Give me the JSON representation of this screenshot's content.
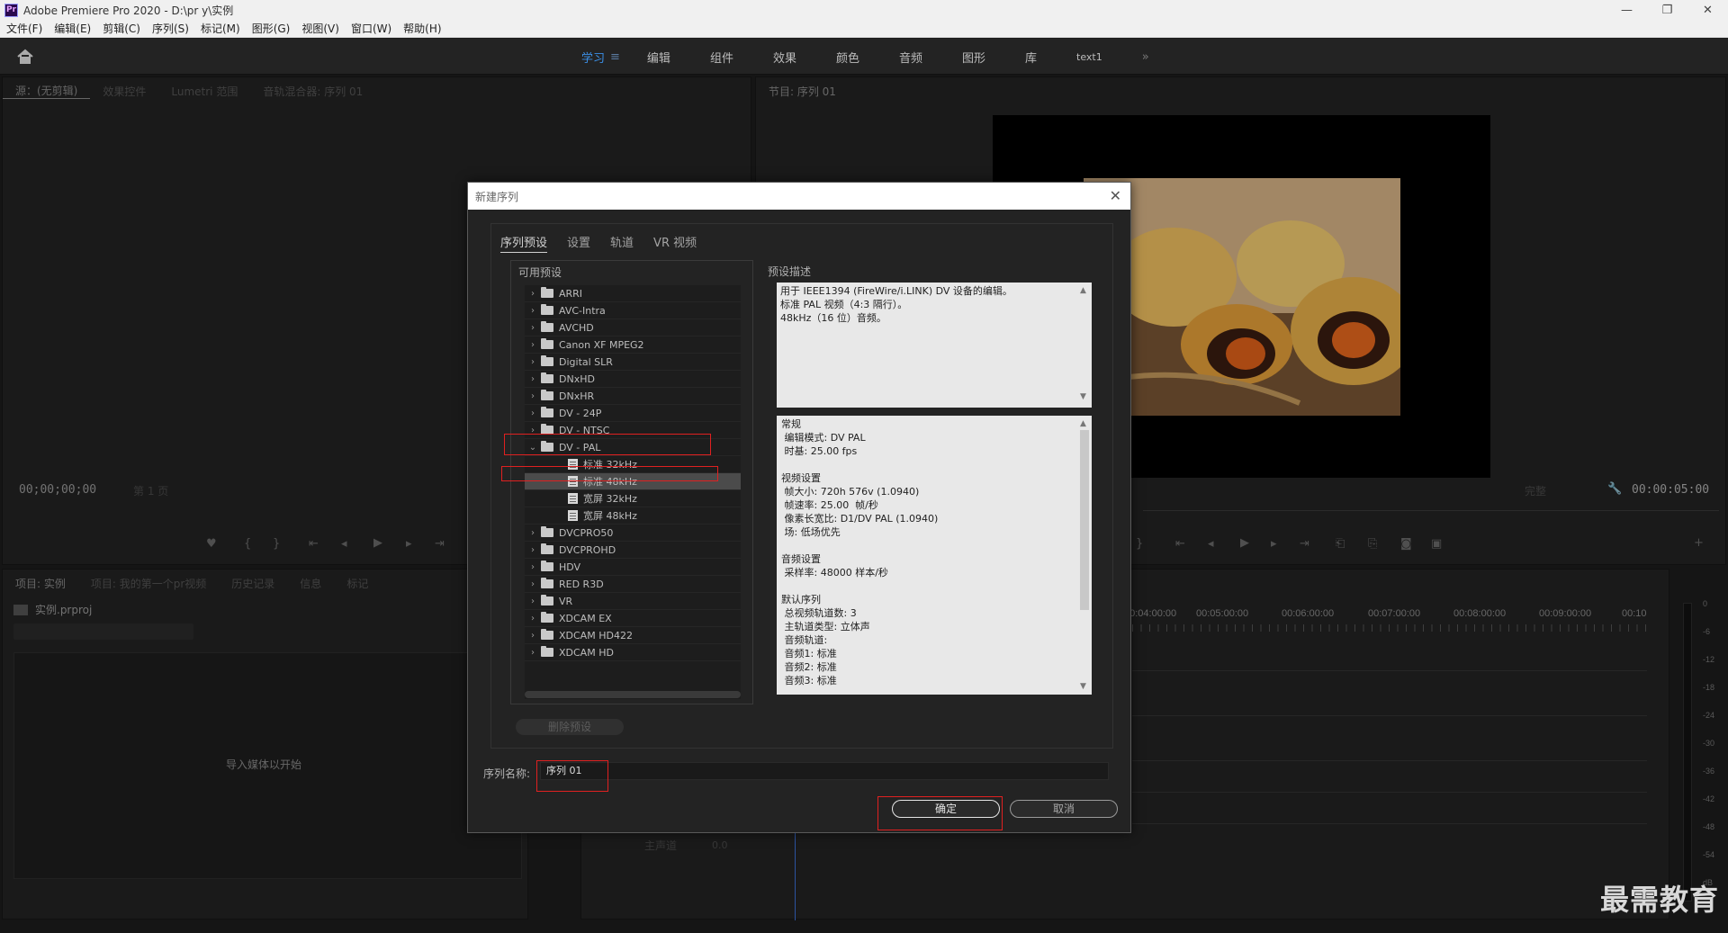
{
  "app": {
    "title": "Adobe Premiere Pro 2020 - D:\\pr y\\实例",
    "logo_text": "Pr",
    "window_controls": {
      "minimize": "—",
      "restore": "❐",
      "close": "✕"
    }
  },
  "menu": [
    "文件(F)",
    "编辑(E)",
    "剪辑(C)",
    "序列(S)",
    "标记(M)",
    "图形(G)",
    "视图(V)",
    "窗口(W)",
    "帮助(H)"
  ],
  "workspace": {
    "tabs": [
      "学习",
      "编辑",
      "组件",
      "效果",
      "颜色",
      "音频",
      "图形",
      "库",
      "text1"
    ],
    "active": "学习",
    "active_menu_glyph": "≡",
    "more_glyph": "»",
    "accent_color": "#3b8fe6"
  },
  "source_panel": {
    "tabs": [
      "源：(无剪辑)",
      "效果控件",
      "Lumetri 范围",
      "音轨混合器: 序列 01"
    ],
    "timecode": "00;00;00;00",
    "page": "第 1 页"
  },
  "program_panel": {
    "tab": "节目: 序列 01",
    "fit": "完整",
    "timecode": "00:00:05:00"
  },
  "project_panel": {
    "tabs": [
      "项目: 实例",
      "项目: 我的第一个pr视频",
      "历史记录",
      "信息",
      "标记"
    ],
    "file": "实例.prproj",
    "empty_message": "导入媒体以开始"
  },
  "timeline": {
    "ruler": [
      "00:04:00:00",
      "00:05:00:00",
      "00:06:00:00",
      "00:07:00:00",
      "00:08:00:00",
      "00:09:00:00",
      "00:10"
    ],
    "master_track": "主声道",
    "master_value": "0.0"
  },
  "meter": {
    "labels": [
      "0",
      "-6",
      "-12",
      "-18",
      "-24",
      "-30",
      "-36",
      "-42",
      "-48",
      "-54",
      "dB"
    ]
  },
  "dialog": {
    "title": "新建序列",
    "close": "✕",
    "tabs": [
      "序列预设",
      "设置",
      "轨道",
      "VR 视频"
    ],
    "active_tab": "序列预设",
    "available_presets_label": "可用预设",
    "presets": [
      {
        "label": "ARRI",
        "type": "folder",
        "expanded": false
      },
      {
        "label": "AVC-Intra",
        "type": "folder",
        "expanded": false
      },
      {
        "label": "AVCHD",
        "type": "folder",
        "expanded": false
      },
      {
        "label": "Canon XF MPEG2",
        "type": "folder",
        "expanded": false
      },
      {
        "label": "Digital SLR",
        "type": "folder",
        "expanded": false
      },
      {
        "label": "DNxHD",
        "type": "folder",
        "expanded": false
      },
      {
        "label": "DNxHR",
        "type": "folder",
        "expanded": false
      },
      {
        "label": "DV - 24P",
        "type": "folder",
        "expanded": false
      },
      {
        "label": "DV - NTSC",
        "type": "folder",
        "expanded": false
      },
      {
        "label": "DV - PAL",
        "type": "folder",
        "expanded": true
      },
      {
        "label": "标准 32kHz",
        "type": "file"
      },
      {
        "label": "标准 48kHz",
        "type": "file",
        "selected": true
      },
      {
        "label": "宽屏 32kHz",
        "type": "file"
      },
      {
        "label": "宽屏 48kHz",
        "type": "file"
      },
      {
        "label": "DVCPRO50",
        "type": "folder",
        "expanded": false
      },
      {
        "label": "DVCPROHD",
        "type": "folder",
        "expanded": false
      },
      {
        "label": "HDV",
        "type": "folder",
        "expanded": false
      },
      {
        "label": "RED R3D",
        "type": "folder",
        "expanded": false
      },
      {
        "label": "VR",
        "type": "folder",
        "expanded": false
      },
      {
        "label": "XDCAM EX",
        "type": "folder",
        "expanded": false
      },
      {
        "label": "XDCAM HD422",
        "type": "folder",
        "expanded": false
      },
      {
        "label": "XDCAM HD",
        "type": "folder",
        "expanded": false
      }
    ],
    "description_label": "预设描述",
    "description": [
      "用于 IEEE1394 (FireWire/i.LINK) DV 设备的编辑。",
      "标准 PAL 视频（4:3 隔行）。",
      "48kHz（16 位）音频。"
    ],
    "details": [
      "常规",
      " 编辑模式: DV PAL",
      " 时基: 25.00 fps",
      "",
      "视频设置",
      " 帧大小: 720h 576v (1.0940)",
      " 帧速率: 25.00  帧/秒",
      " 像素长宽比: D1/DV PAL (1.0940)",
      " 场: 低场优先",
      "",
      "音频设置",
      " 采样率: 48000 样本/秒",
      "",
      "默认序列",
      " 总视频轨道数: 3",
      " 主轨道类型: 立体声",
      " 音频轨道:",
      " 音频1: 标准",
      " 音频2: 标准",
      " 音频3: 标准"
    ],
    "delete_preset": "删除预设",
    "sequence_name_label": "序列名称:",
    "sequence_name": "序列 01",
    "ok": "确定",
    "cancel": "取消",
    "highlight_color": "#e02020"
  },
  "watermark": "最需教育"
}
